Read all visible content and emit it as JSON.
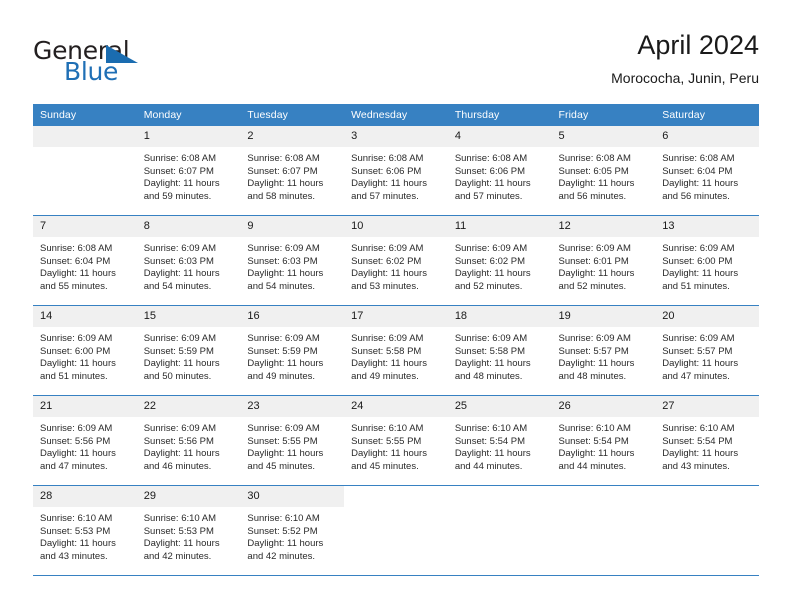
{
  "brand": {
    "name_part1": "General",
    "name_part2": "Blue",
    "accent_color": "#1a6cb0"
  },
  "header": {
    "title": "April 2024",
    "subtitle": "Morococha, Junin, Peru"
  },
  "theme": {
    "header_row_color": "#3781c2",
    "daynum_band_color": "#f0f0f0",
    "row_divider_color": "#3781c2"
  },
  "weekday_headers": [
    "Sunday",
    "Monday",
    "Tuesday",
    "Wednesday",
    "Thursday",
    "Friday",
    "Saturday"
  ],
  "weeks": [
    [
      {
        "day": "",
        "sunrise": "",
        "sunset": "",
        "daylight_line1": "",
        "daylight_line2": "",
        "empty": true
      },
      {
        "day": "1",
        "sunrise": "Sunrise: 6:08 AM",
        "sunset": "Sunset: 6:07 PM",
        "daylight_line1": "Daylight: 11 hours",
        "daylight_line2": "and 59 minutes."
      },
      {
        "day": "2",
        "sunrise": "Sunrise: 6:08 AM",
        "sunset": "Sunset: 6:07 PM",
        "daylight_line1": "Daylight: 11 hours",
        "daylight_line2": "and 58 minutes."
      },
      {
        "day": "3",
        "sunrise": "Sunrise: 6:08 AM",
        "sunset": "Sunset: 6:06 PM",
        "daylight_line1": "Daylight: 11 hours",
        "daylight_line2": "and 57 minutes."
      },
      {
        "day": "4",
        "sunrise": "Sunrise: 6:08 AM",
        "sunset": "Sunset: 6:06 PM",
        "daylight_line1": "Daylight: 11 hours",
        "daylight_line2": "and 57 minutes."
      },
      {
        "day": "5",
        "sunrise": "Sunrise: 6:08 AM",
        "sunset": "Sunset: 6:05 PM",
        "daylight_line1": "Daylight: 11 hours",
        "daylight_line2": "and 56 minutes."
      },
      {
        "day": "6",
        "sunrise": "Sunrise: 6:08 AM",
        "sunset": "Sunset: 6:04 PM",
        "daylight_line1": "Daylight: 11 hours",
        "daylight_line2": "and 56 minutes."
      }
    ],
    [
      {
        "day": "7",
        "sunrise": "Sunrise: 6:08 AM",
        "sunset": "Sunset: 6:04 PM",
        "daylight_line1": "Daylight: 11 hours",
        "daylight_line2": "and 55 minutes."
      },
      {
        "day": "8",
        "sunrise": "Sunrise: 6:09 AM",
        "sunset": "Sunset: 6:03 PM",
        "daylight_line1": "Daylight: 11 hours",
        "daylight_line2": "and 54 minutes."
      },
      {
        "day": "9",
        "sunrise": "Sunrise: 6:09 AM",
        "sunset": "Sunset: 6:03 PM",
        "daylight_line1": "Daylight: 11 hours",
        "daylight_line2": "and 54 minutes."
      },
      {
        "day": "10",
        "sunrise": "Sunrise: 6:09 AM",
        "sunset": "Sunset: 6:02 PM",
        "daylight_line1": "Daylight: 11 hours",
        "daylight_line2": "and 53 minutes."
      },
      {
        "day": "11",
        "sunrise": "Sunrise: 6:09 AM",
        "sunset": "Sunset: 6:02 PM",
        "daylight_line1": "Daylight: 11 hours",
        "daylight_line2": "and 52 minutes."
      },
      {
        "day": "12",
        "sunrise": "Sunrise: 6:09 AM",
        "sunset": "Sunset: 6:01 PM",
        "daylight_line1": "Daylight: 11 hours",
        "daylight_line2": "and 52 minutes."
      },
      {
        "day": "13",
        "sunrise": "Sunrise: 6:09 AM",
        "sunset": "Sunset: 6:00 PM",
        "daylight_line1": "Daylight: 11 hours",
        "daylight_line2": "and 51 minutes."
      }
    ],
    [
      {
        "day": "14",
        "sunrise": "Sunrise: 6:09 AM",
        "sunset": "Sunset: 6:00 PM",
        "daylight_line1": "Daylight: 11 hours",
        "daylight_line2": "and 51 minutes."
      },
      {
        "day": "15",
        "sunrise": "Sunrise: 6:09 AM",
        "sunset": "Sunset: 5:59 PM",
        "daylight_line1": "Daylight: 11 hours",
        "daylight_line2": "and 50 minutes."
      },
      {
        "day": "16",
        "sunrise": "Sunrise: 6:09 AM",
        "sunset": "Sunset: 5:59 PM",
        "daylight_line1": "Daylight: 11 hours",
        "daylight_line2": "and 49 minutes."
      },
      {
        "day": "17",
        "sunrise": "Sunrise: 6:09 AM",
        "sunset": "Sunset: 5:58 PM",
        "daylight_line1": "Daylight: 11 hours",
        "daylight_line2": "and 49 minutes."
      },
      {
        "day": "18",
        "sunrise": "Sunrise: 6:09 AM",
        "sunset": "Sunset: 5:58 PM",
        "daylight_line1": "Daylight: 11 hours",
        "daylight_line2": "and 48 minutes."
      },
      {
        "day": "19",
        "sunrise": "Sunrise: 6:09 AM",
        "sunset": "Sunset: 5:57 PM",
        "daylight_line1": "Daylight: 11 hours",
        "daylight_line2": "and 48 minutes."
      },
      {
        "day": "20",
        "sunrise": "Sunrise: 6:09 AM",
        "sunset": "Sunset: 5:57 PM",
        "daylight_line1": "Daylight: 11 hours",
        "daylight_line2": "and 47 minutes."
      }
    ],
    [
      {
        "day": "21",
        "sunrise": "Sunrise: 6:09 AM",
        "sunset": "Sunset: 5:56 PM",
        "daylight_line1": "Daylight: 11 hours",
        "daylight_line2": "and 47 minutes."
      },
      {
        "day": "22",
        "sunrise": "Sunrise: 6:09 AM",
        "sunset": "Sunset: 5:56 PM",
        "daylight_line1": "Daylight: 11 hours",
        "daylight_line2": "and 46 minutes."
      },
      {
        "day": "23",
        "sunrise": "Sunrise: 6:09 AM",
        "sunset": "Sunset: 5:55 PM",
        "daylight_line1": "Daylight: 11 hours",
        "daylight_line2": "and 45 minutes."
      },
      {
        "day": "24",
        "sunrise": "Sunrise: 6:10 AM",
        "sunset": "Sunset: 5:55 PM",
        "daylight_line1": "Daylight: 11 hours",
        "daylight_line2": "and 45 minutes."
      },
      {
        "day": "25",
        "sunrise": "Sunrise: 6:10 AM",
        "sunset": "Sunset: 5:54 PM",
        "daylight_line1": "Daylight: 11 hours",
        "daylight_line2": "and 44 minutes."
      },
      {
        "day": "26",
        "sunrise": "Sunrise: 6:10 AM",
        "sunset": "Sunset: 5:54 PM",
        "daylight_line1": "Daylight: 11 hours",
        "daylight_line2": "and 44 minutes."
      },
      {
        "day": "27",
        "sunrise": "Sunrise: 6:10 AM",
        "sunset": "Sunset: 5:54 PM",
        "daylight_line1": "Daylight: 11 hours",
        "daylight_line2": "and 43 minutes."
      }
    ],
    [
      {
        "day": "28",
        "sunrise": "Sunrise: 6:10 AM",
        "sunset": "Sunset: 5:53 PM",
        "daylight_line1": "Daylight: 11 hours",
        "daylight_line2": "and 43 minutes."
      },
      {
        "day": "29",
        "sunrise": "Sunrise: 6:10 AM",
        "sunset": "Sunset: 5:53 PM",
        "daylight_line1": "Daylight: 11 hours",
        "daylight_line2": "and 42 minutes."
      },
      {
        "day": "30",
        "sunrise": "Sunrise: 6:10 AM",
        "sunset": "Sunset: 5:52 PM",
        "daylight_line1": "Daylight: 11 hours",
        "daylight_line2": "and 42 minutes."
      },
      {
        "day": "",
        "sunrise": "",
        "sunset": "",
        "daylight_line1": "",
        "daylight_line2": "",
        "blank": true
      },
      {
        "day": "",
        "sunrise": "",
        "sunset": "",
        "daylight_line1": "",
        "daylight_line2": "",
        "blank": true
      },
      {
        "day": "",
        "sunrise": "",
        "sunset": "",
        "daylight_line1": "",
        "daylight_line2": "",
        "blank": true
      },
      {
        "day": "",
        "sunrise": "",
        "sunset": "",
        "daylight_line1": "",
        "daylight_line2": "",
        "blank": true
      }
    ]
  ]
}
